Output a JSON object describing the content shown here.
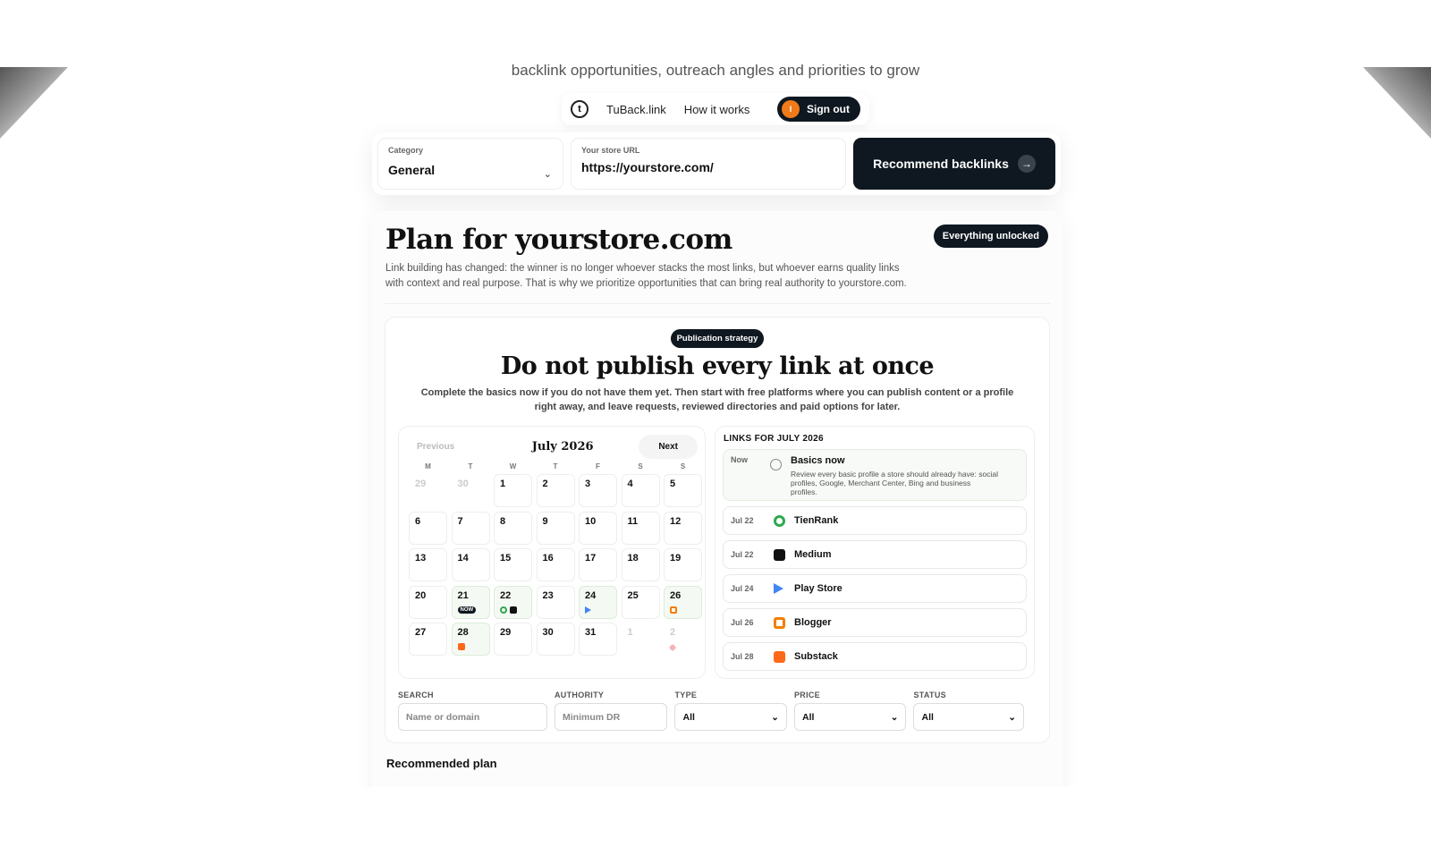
{
  "subtitle": "backlink opportunities, outreach angles and priorities to grow",
  "nav": {
    "brand": "TuBack.link",
    "how_it_works": "How it works",
    "signout": "Sign out",
    "avatar_initial": "I"
  },
  "search": {
    "category_label": "Category",
    "category_value": "General",
    "url_label": "Your store URL",
    "url_value": "https://yourstore.com/",
    "button": "Recommend backlinks"
  },
  "plan": {
    "title": "Plan for yourstore.com",
    "badge": "Everything unlocked",
    "description": "Link building has changed: the winner is no longer whoever stacks the most links, but whoever earns quality links with context and real purpose. That is why we prioritize opportunities that can bring real authority to yourstore.com."
  },
  "strategy": {
    "pill": "Publication strategy",
    "title": "Do not publish every link at once",
    "description": "Complete the basics now if you do not have them yet. Then start with free platforms where you can publish content or a profile right away, and leave requests, reviewed directories and paid options for later."
  },
  "calendar": {
    "prev": "Previous",
    "month": "July 2026",
    "next": "Next",
    "weekdays": [
      "M",
      "T",
      "W",
      "T",
      "F",
      "S",
      "S"
    ],
    "now_tag": "NOW",
    "days": [
      "29",
      "30",
      "1",
      "2",
      "3",
      "4",
      "5",
      "6",
      "7",
      "8",
      "9",
      "10",
      "11",
      "12",
      "13",
      "14",
      "15",
      "16",
      "17",
      "18",
      "19",
      "20",
      "21",
      "22",
      "23",
      "24",
      "25",
      "26",
      "27",
      "28",
      "29",
      "30",
      "31",
      "1",
      "2"
    ]
  },
  "links": {
    "title": "LINKS FOR JULY 2026",
    "now": {
      "date": "Now",
      "name": "Basics now",
      "desc": "Review every basic profile a store should already have: social profiles, Google, Merchant Center, Bing and business profiles."
    },
    "items": [
      {
        "date": "Jul 22",
        "name": "TienRank",
        "icon": "tienrank-icon"
      },
      {
        "date": "Jul 22",
        "name": "Medium",
        "icon": "medium-icon"
      },
      {
        "date": "Jul 24",
        "name": "Play Store",
        "icon": "play-store-icon"
      },
      {
        "date": "Jul 26",
        "name": "Blogger",
        "icon": "blogger-icon"
      },
      {
        "date": "Jul 28",
        "name": "Substack",
        "icon": "substack-icon"
      }
    ]
  },
  "filters": {
    "search_label": "SEARCH",
    "search_placeholder": "Name or domain",
    "authority_label": "AUTHORITY",
    "authority_placeholder": "Minimum DR",
    "type_label": "TYPE",
    "type_value": "All",
    "price_label": "PRICE",
    "price_value": "All",
    "status_label": "STATUS",
    "status_value": "All"
  },
  "recommended_plan": "Recommended plan",
  "colors": {
    "dark": "#0f1720",
    "avatar": "#f07a1a",
    "tienrank": "#2fa84f",
    "medium": "#111111",
    "blogger": "#f57d00",
    "substack": "#ff6719"
  }
}
